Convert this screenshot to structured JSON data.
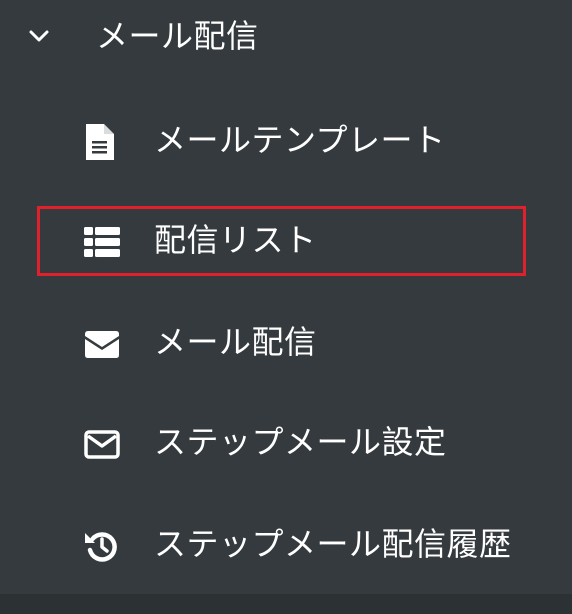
{
  "section": {
    "title": "メール配信",
    "icon": "chevron-down-icon"
  },
  "menu": {
    "items": [
      {
        "label": "メールテンプレート",
        "icon": "file-document-icon"
      },
      {
        "label": "配信リスト",
        "icon": "list-icon",
        "highlighted": true
      },
      {
        "label": "メール配信",
        "icon": "envelope-filled-icon"
      },
      {
        "label": "ステップメール設定",
        "icon": "envelope-outline-icon"
      },
      {
        "label": "ステップメール配信履歴",
        "icon": "history-icon"
      }
    ]
  },
  "colors": {
    "background": "#343a3d",
    "text": "#ffffff",
    "highlight_border": "#e0202a"
  }
}
